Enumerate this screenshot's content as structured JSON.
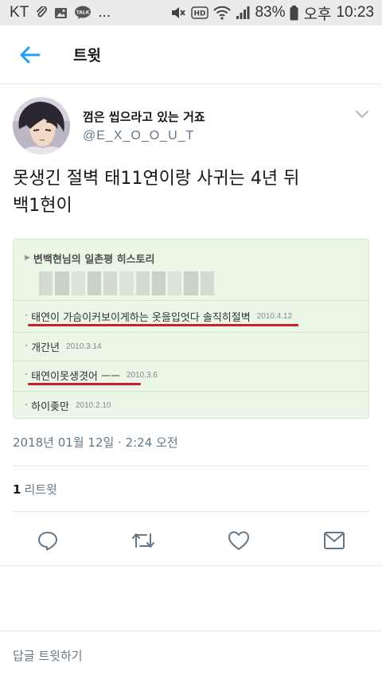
{
  "status_bar": {
    "carrier": "KT",
    "battery": "83%",
    "ampm": "오후",
    "time": "10:23",
    "hd_label": "HD",
    "talk_label": "TALK",
    "more": "..."
  },
  "header": {
    "title": "트윗",
    "back_icon": "arrow-left-icon",
    "accent": "#1da1f2"
  },
  "tweet": {
    "display_name": "껌은 씹으라고 있는 거죠",
    "handle": "@E_X_O_O_U_T",
    "text": "못생긴 절벽 태11연이랑 사귀는 4년 뒤\n백1현이",
    "timestamp": "2018년 01월 12일 · 2:24 오전",
    "retweet_count": "1",
    "retweet_label": "리트윗"
  },
  "media": {
    "title": "변백현님의 일촌평 히스토리",
    "items": [
      {
        "text": "태연이 가슴이커보이게하는 옷을입엇다 솔직히절벽",
        "date": "2010.4.12",
        "underlined": true
      },
      {
        "text": "개간년",
        "date": "2010.3.14",
        "underlined": false
      },
      {
        "text": "태연이못생겻어 ㅡㅡ",
        "date": "2010.3.6",
        "underlined": true
      },
      {
        "text": "하이좆만",
        "date": "2010.2.10",
        "underlined": false
      }
    ],
    "background": "#eaf6e6",
    "underline_color": "#c8202f"
  },
  "actions": [
    {
      "name": "reply-icon"
    },
    {
      "name": "retweet-icon"
    },
    {
      "name": "like-icon"
    },
    {
      "name": "share-icon"
    }
  ],
  "reply": {
    "placeholder": "답글 트윗하기"
  },
  "colors": {
    "text": "#14171a",
    "secondary": "#657786",
    "divider": "#e1e8ed",
    "status_bar_bg": "#ebebeb"
  }
}
